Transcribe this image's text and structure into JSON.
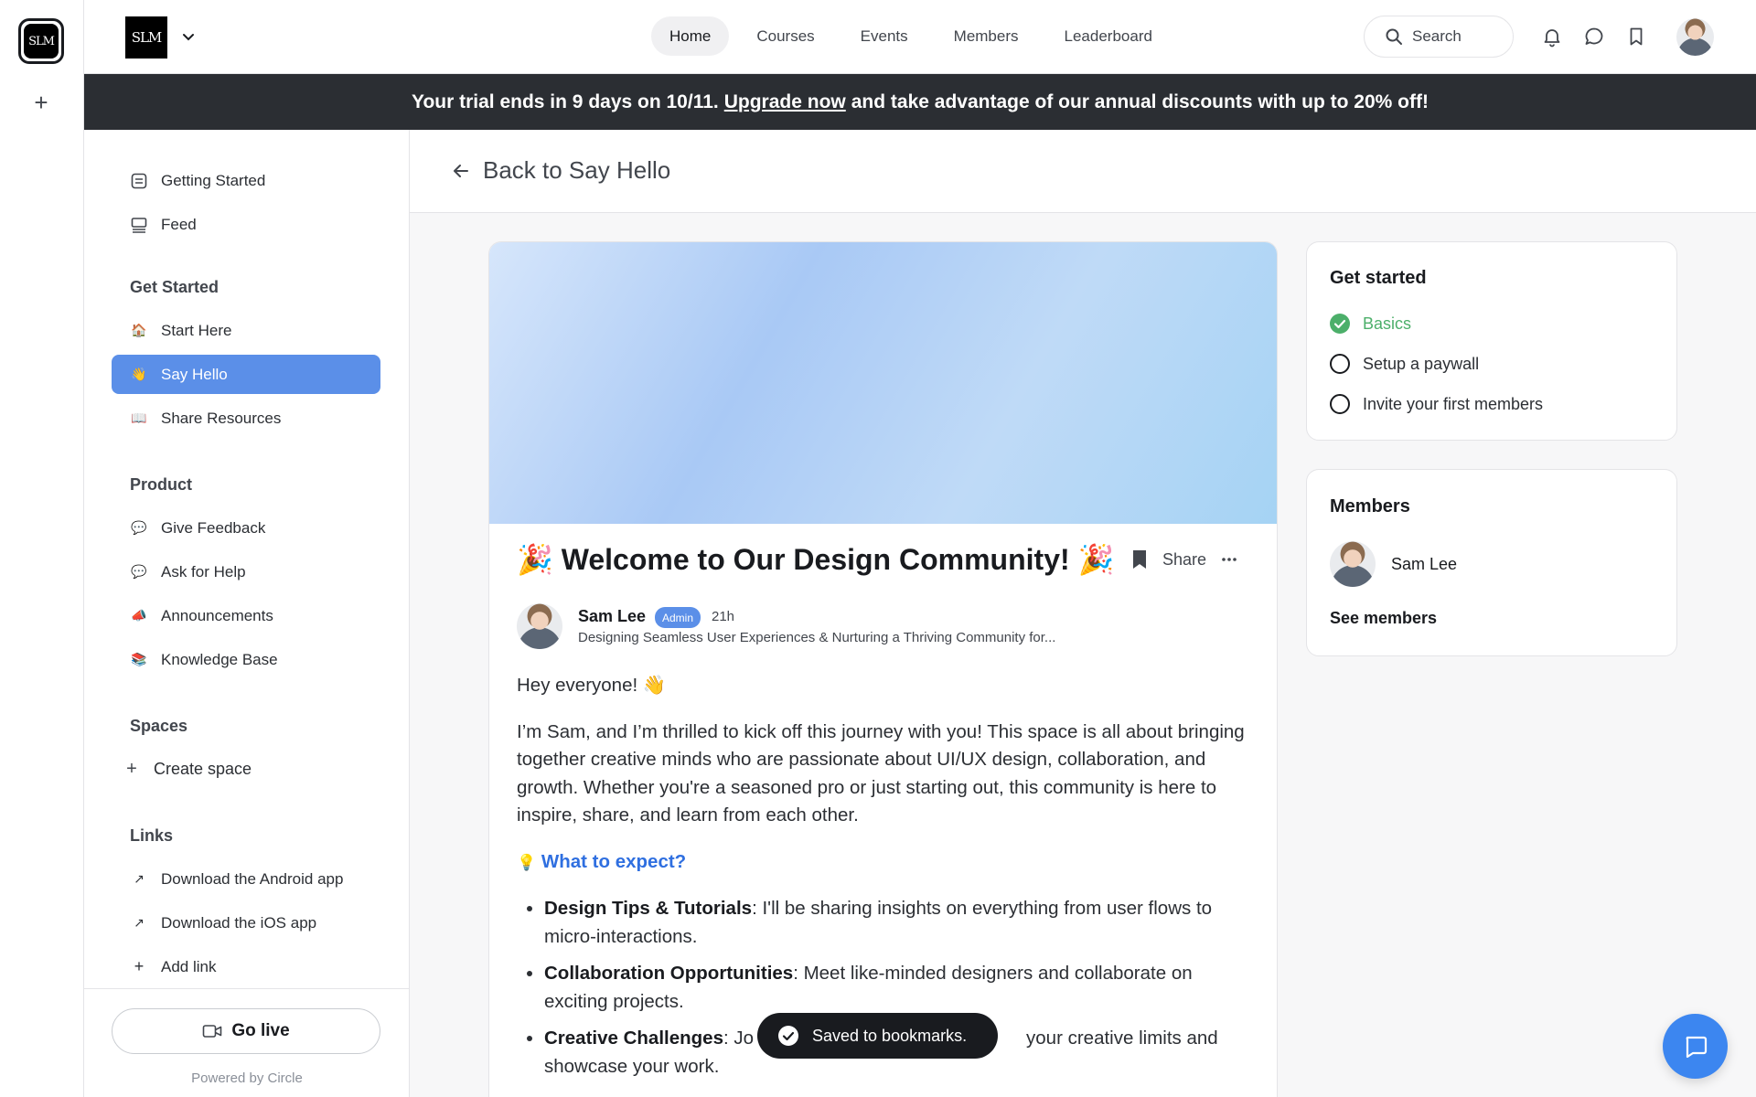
{
  "rail": {
    "logo_text": "SLM"
  },
  "header": {
    "brand_text": "SLM",
    "nav": [
      {
        "label": "Home",
        "active": true
      },
      {
        "label": "Courses",
        "active": false
      },
      {
        "label": "Events",
        "active": false
      },
      {
        "label": "Members",
        "active": false
      },
      {
        "label": "Leaderboard",
        "active": false
      }
    ],
    "search_label": "Search"
  },
  "banner": {
    "prefix": "Your trial ends in 9 days on 10/11.",
    "link": "Upgrade now",
    "suffix": "and take advantage of our annual discounts with up to 20% off!"
  },
  "sidebar": {
    "top_items": [
      {
        "label": "Getting Started",
        "icon": "checklist-icon"
      },
      {
        "label": "Feed",
        "icon": "feed-icon"
      }
    ],
    "groups": [
      {
        "heading": "Get Started",
        "items": [
          {
            "label": "Start Here",
            "icon": "🏠",
            "active": false
          },
          {
            "label": "Say Hello",
            "icon": "👋",
            "active": true
          },
          {
            "label": "Share Resources",
            "icon": "📖",
            "active": false
          }
        ]
      },
      {
        "heading": "Product",
        "items": [
          {
            "label": "Give Feedback",
            "icon": "💬"
          },
          {
            "label": "Ask for Help",
            "icon": "💬"
          },
          {
            "label": "Announcements",
            "icon": "📣"
          },
          {
            "label": "Knowledge Base",
            "icon": "📚"
          }
        ]
      },
      {
        "heading": "Spaces",
        "items": [
          {
            "label": "Create space",
            "icon": "+"
          }
        ]
      },
      {
        "heading": "Links",
        "items": [
          {
            "label": "Download the Android app",
            "icon": "↗"
          },
          {
            "label": "Download the iOS app",
            "icon": "↗"
          },
          {
            "label": "Add link",
            "icon": "+"
          }
        ]
      }
    ],
    "go_live": "Go live",
    "powered_by": "Powered by Circle"
  },
  "main": {
    "back_label": "Back to Say Hello",
    "post": {
      "title": "🎉 Welcome to Our Design Community! 🎉",
      "share_label": "Share",
      "author": "Sam Lee",
      "badge": "Admin",
      "time": "21h",
      "tagline": "Designing Seamless User Experiences & Nurturing a Thriving Community for...",
      "greeting": "Hey everyone! 👋",
      "intro": "I’m Sam, and I’m thrilled to kick off this journey with you! This space is all about bringing together creative minds who are passionate about UI/UX design, collaboration, and growth. Whether you're a seasoned pro or just starting out, this community is here to inspire, share, and learn from each other.",
      "expect_icon": "💡",
      "expect_heading": "What to expect?",
      "bullets": [
        {
          "bold": "Design Tips & Tutorials",
          "text": ": I'll be sharing insights on everything from user flows to micro-interactions."
        },
        {
          "bold": "Collaboration Opportunities",
          "text": ": Meet like-minded designers and collaborate on exciting projects."
        },
        {
          "bold": "Creative Challenges",
          "text": ": Jo",
          "text2": "your creative limits and showcase your work."
        }
      ]
    }
  },
  "right": {
    "get_started": {
      "title": "Get started",
      "items": [
        {
          "label": "Basics",
          "done": true
        },
        {
          "label": "Setup a paywall",
          "done": false
        },
        {
          "label": "Invite your first members",
          "done": false
        }
      ]
    },
    "members": {
      "title": "Members",
      "member_name": "Sam Lee",
      "see_all": "See members"
    }
  },
  "toast": {
    "text": "Saved to bookmarks."
  }
}
